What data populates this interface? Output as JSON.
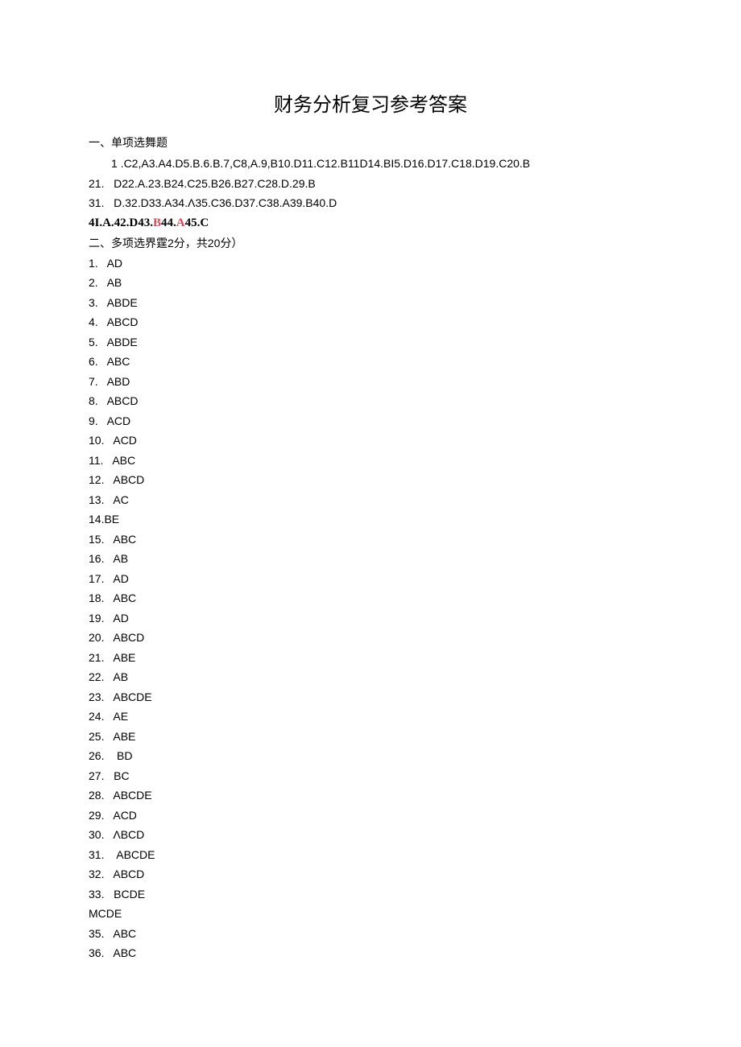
{
  "title": "财务分析复习参考答案",
  "section1": {
    "header": "一、单项选舞题",
    "lines": [
      "1 .C2,A3.A4.D5.B.6.B.7,C8,A.9,B10.D11.C12.B11D14.BI5.D16.D17.C18.D19.C20.B",
      "21.   D22.A.23.B24.C25.B26.B27.C28.D.29.B",
      "31.   D.32.D33.A34.Λ35.C36.D37.C38.A39.B40.D"
    ],
    "bold": {
      "p1": "4I.A.42.D43.",
      "p2": "B",
      "p3": "44.",
      "p4": "A",
      "p5": "45.C"
    }
  },
  "section2": {
    "header": "二、多项选界霆2分，共20分）",
    "items": [
      "1.   AD",
      "2.   AB",
      "3.   ABDE",
      "4.   ABCD",
      "5.   ABDE",
      "6.   ABC",
      "7.   ABD",
      "8.   ABCD",
      "9.   ACD",
      "10.   ACD",
      "11.   ABC",
      "12.   ABCD",
      "13.   AC",
      "14.BE",
      "15.   ABC",
      "16.   AB",
      "17.   AD",
      "18.   ABC",
      "19.   AD",
      "20.   ABCD",
      "21.   ABE",
      "22.   AB",
      "23.   ABCDE",
      "24.   AE",
      "25.   ABE",
      "26.    BD",
      "27.   BC",
      "28.   ABCDE",
      "29.   ACD",
      "30.   ΛBCD",
      "31.    ABCDE",
      "32.   ABCD",
      "33.   BCDE",
      "MCDE",
      "35.   ABC",
      "36.   ABC"
    ]
  }
}
